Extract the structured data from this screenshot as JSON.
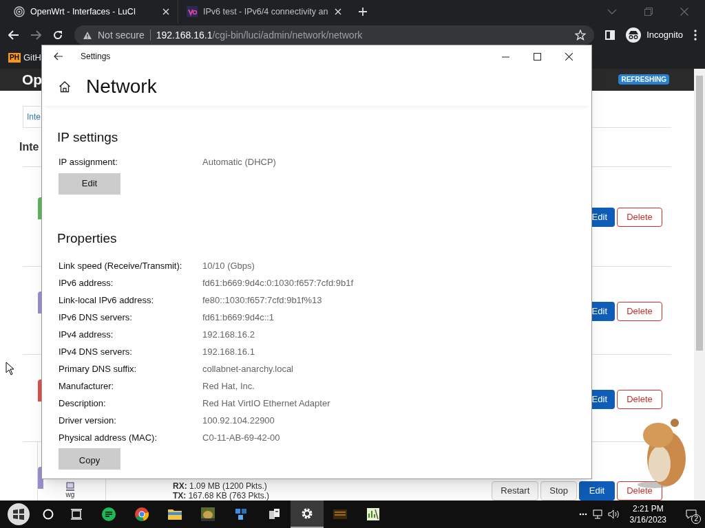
{
  "browser": {
    "tabs": [
      {
        "title": "OpenWrt - Interfaces - LuCI",
        "selected": true
      },
      {
        "title": "IPv6 test - IPv6/4 connectivity an",
        "selected": false
      }
    ],
    "address": {
      "security": "Not secure",
      "host": "192.168.16.1",
      "path": "/cgi-bin/luci/admin/network/network"
    },
    "profile": "Incognito",
    "bookmarks": [
      {
        "badge": "PH",
        "label": "GitH"
      }
    ]
  },
  "luci": {
    "brand": "Op",
    "badge": "REFRESHING",
    "tab": "Inte",
    "heading": "Inte",
    "interfaces": [
      {
        "color": "#5cb85c",
        "buttons": [
          "Edit",
          "Delete"
        ]
      },
      {
        "color": "#9b8fd0",
        "buttons": [
          "Edit",
          "Delete"
        ]
      },
      {
        "color": "#d9534f",
        "buttons": [
          "Edit",
          "Delete"
        ]
      },
      {
        "color": "#9b8fd0",
        "device": "wg",
        "rx_label": "RX:",
        "rx": "1.09 MB (1200 Pkts.)",
        "tx_label": "TX:",
        "tx": "167.68 KB (763 Pkts.)",
        "buttons": [
          "Restart",
          "Stop",
          "Edit",
          "Delete"
        ]
      }
    ]
  },
  "settings": {
    "title": "Settings",
    "heading": "Network",
    "ip_settings": {
      "title": "IP settings",
      "label": "IP assignment:",
      "value": "Automatic (DHCP)",
      "button": "Edit"
    },
    "properties": {
      "title": "Properties",
      "rows": [
        {
          "label": "Link speed (Receive/Transmit):",
          "value": "10/10 (Gbps)"
        },
        {
          "label": "IPv6 address:",
          "value": "fd61:b669:9d4c:0:1030:f657:7cfd:9b1f"
        },
        {
          "label": "Link-local IPv6 address:",
          "value": "fe80::1030:f657:7cfd:9b1f%13"
        },
        {
          "label": "IPv6 DNS servers:",
          "value": "fd61:b669:9d4c::1"
        },
        {
          "label": "IPv4 address:",
          "value": "192.168.16.2"
        },
        {
          "label": "IPv4 DNS servers:",
          "value": "192.168.16.1"
        },
        {
          "label": "Primary DNS suffix:",
          "value": "collabnet-anarchy.local"
        },
        {
          "label": "Manufacturer:",
          "value": "Red Hat, Inc."
        },
        {
          "label": "Description:",
          "value": "Red Hat VirtIO Ethernet Adapter"
        },
        {
          "label": "Driver version:",
          "value": "100.92.104.22900"
        },
        {
          "label": "Physical address (MAC):",
          "value": "C0-11-AB-69-42-00"
        }
      ],
      "button": "Copy"
    }
  },
  "taskbar": {
    "apps": [
      {
        "kind": "chat",
        "selected": false
      },
      {
        "kind": "chrome",
        "selected": false
      },
      {
        "kind": "folder",
        "selected": false
      },
      {
        "kind": "game",
        "selected": false
      },
      {
        "kind": "cubes",
        "selected": false
      },
      {
        "kind": "server",
        "selected": false
      },
      {
        "kind": "settings",
        "selected": true
      },
      {
        "kind": "tape",
        "selected": false
      },
      {
        "kind": "chart",
        "selected": false
      }
    ],
    "time": "2:21 PM",
    "date": "3/16/2023",
    "notifications": "2"
  }
}
